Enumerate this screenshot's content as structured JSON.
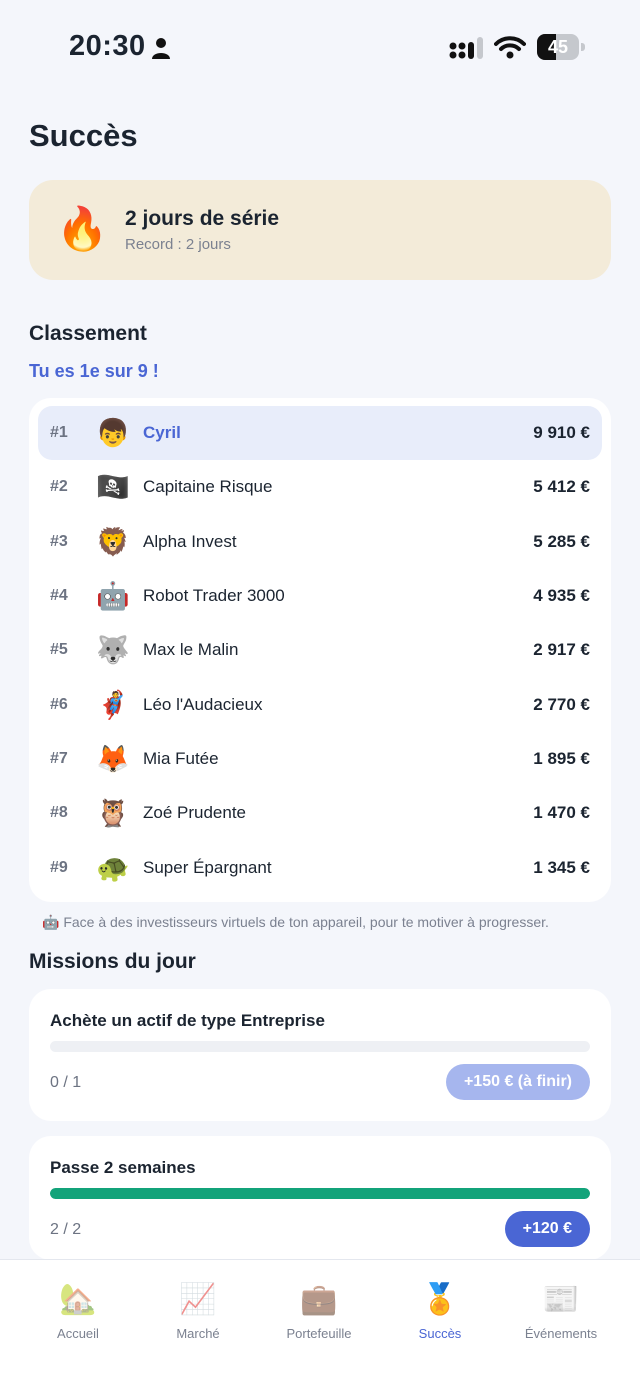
{
  "status_bar": {
    "time": "20:30",
    "battery": "45",
    "battery_level": 0.45
  },
  "page": {
    "title": "Succès"
  },
  "streak": {
    "icon": "🔥",
    "title": "2 jours de série",
    "record": "Record : 2 jours"
  },
  "leaderboard": {
    "title": "Classement",
    "subtitle": "Tu es 1e sur 9 !",
    "rows": [
      {
        "rank": "#1",
        "avatar": "👦",
        "name": "Cyril",
        "value": "9 910 €"
      },
      {
        "rank": "#2",
        "avatar": "🏴‍☠️",
        "name": "Capitaine Risque",
        "value": "5 412 €"
      },
      {
        "rank": "#3",
        "avatar": "🦁",
        "name": "Alpha Invest",
        "value": "5 285 €"
      },
      {
        "rank": "#4",
        "avatar": "🤖",
        "name": "Robot Trader 3000",
        "value": "4 935 €"
      },
      {
        "rank": "#5",
        "avatar": "🐺",
        "name": "Max le Malin",
        "value": "2 917 €"
      },
      {
        "rank": "#6",
        "avatar": "🦸",
        "name": "Léo l'Audacieux",
        "value": "2 770 €"
      },
      {
        "rank": "#7",
        "avatar": "🦊",
        "name": "Mia Futée",
        "value": "1 895 €"
      },
      {
        "rank": "#8",
        "avatar": "🦉",
        "name": "Zoé Prudente",
        "value": "1 470 €"
      },
      {
        "rank": "#9",
        "avatar": "🐢",
        "name": "Super Épargnant",
        "value": "1 345 €"
      }
    ],
    "note": "🤖 Face à des investisseurs virtuels de ton appareil, pour te motiver à progresser."
  },
  "missions": {
    "title": "Missions du jour",
    "items": [
      {
        "title": "Achète un actif de type Entreprise",
        "count": "0 / 1",
        "progress": 0,
        "reward": "+150 € (à finir)"
      },
      {
        "title": "Passe 2 semaines",
        "count": "2 / 2",
        "progress": 1,
        "reward": "+120 €"
      }
    ]
  },
  "tabs": [
    {
      "icon": "🏡",
      "label": "Accueil",
      "active": false
    },
    {
      "icon": "📈",
      "label": "Marché",
      "active": false
    },
    {
      "icon": "💼",
      "label": "Portefeuille",
      "active": false
    },
    {
      "icon": "🏅",
      "label": "Succès",
      "active": true
    },
    {
      "icon": "📰",
      "label": "Événements",
      "active": false
    }
  ],
  "colors": {
    "accent": "#4a66d4",
    "accent_light": "#a6b6ee",
    "progress_green": "#13a37a",
    "streak_bg": "#f3ebd9",
    "page_bg": "#f4f6fb"
  }
}
